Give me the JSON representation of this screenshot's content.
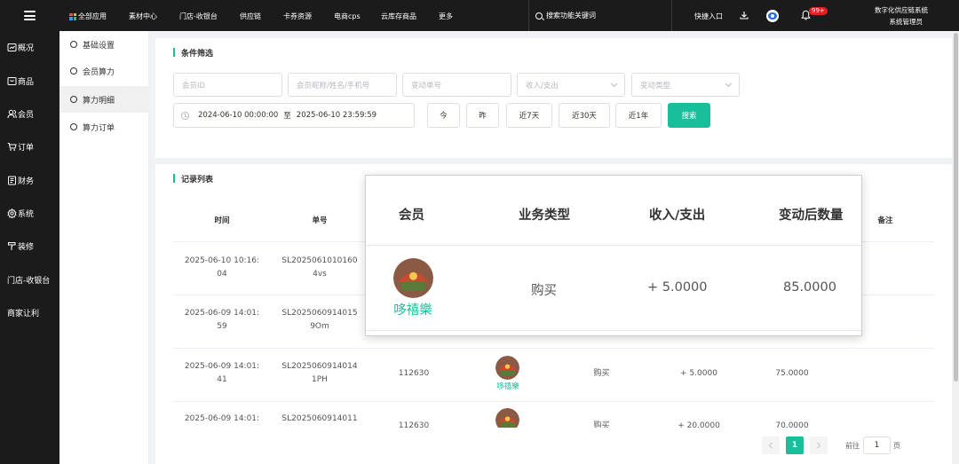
{
  "topbar": {
    "nav": [
      "全部应用",
      "素材中心",
      "门店-收银台",
      "供应链",
      "卡券资源",
      "电商cps",
      "云库存商品",
      "更多"
    ],
    "search_placeholder": "搜索功能关键词",
    "quick_entry": "快捷入口",
    "notification_badge": "99+",
    "system_title": "数字化供应链系统",
    "user_name": "系统管理员"
  },
  "sidebar": {
    "items": [
      "概况",
      "商品",
      "会员",
      "订单",
      "财务",
      "系统",
      "装修",
      "门店-收银台",
      "商家让利"
    ]
  },
  "submenu": {
    "items": [
      "基础设置",
      "会员算力",
      "算力明细",
      "算力订单"
    ],
    "active_index": 2
  },
  "filter": {
    "title": "条件筛选",
    "member_id_placeholder": "会员ID",
    "member_name_placeholder": "会员昵称/姓名/手机号",
    "change_no_placeholder": "变动单号",
    "in_out_placeholder": "收入/支出",
    "change_type_placeholder": "变动类型",
    "date_start": "2024-06-10 00:00:00",
    "date_sep": "至",
    "date_end": "2025-06-10 23:59:59",
    "buttons": [
      "今",
      "昨",
      "近7天",
      "近30天",
      "近1年"
    ],
    "search_button": "搜索"
  },
  "records": {
    "title": "记录列表",
    "columns": [
      "时间",
      "单号",
      "备注"
    ],
    "rows": [
      {
        "time_line1": "2025-06-10 10:16:",
        "time_line2": "04",
        "no_line1": "SL202506101016​0",
        "no_line2": "4vs"
      },
      {
        "time_line1": "2025-06-09 14:01:",
        "time_line2": "59",
        "no_line1": "SL2025060914015",
        "no_line2": "9Om"
      },
      {
        "time_line1": "2025-06-09 14:01:",
        "time_line2": "41",
        "no_line1": "SL2025060914014",
        "no_line2": "1PH",
        "member_id": "112630",
        "member_name": "哆禧樂",
        "type": "购买",
        "amount": "+ 5.0000",
        "after": "75.0000"
      },
      {
        "time_line1": "2025-06-09 14:01:",
        "time_line2": "",
        "no_line1": "SL2025060914011",
        "no_line2": "",
        "member_id": "112630",
        "type": "购买",
        "amount": "+ 20.0000",
        "after": "70.0000"
      }
    ]
  },
  "pager": {
    "current_page": "1",
    "goto_label": "前往",
    "page_input": "1",
    "page_suffix": "页"
  },
  "popup": {
    "headers": [
      "会员",
      "业务类型",
      "收入/支出",
      "变动后数量"
    ],
    "member_name": "哆禧樂",
    "type": "购买",
    "amount": "+ 5.0000",
    "after": "85.0000"
  },
  "colors": {
    "accent": "#19be9b",
    "topbar": "#1b1b1b",
    "badge": "#e02020"
  }
}
